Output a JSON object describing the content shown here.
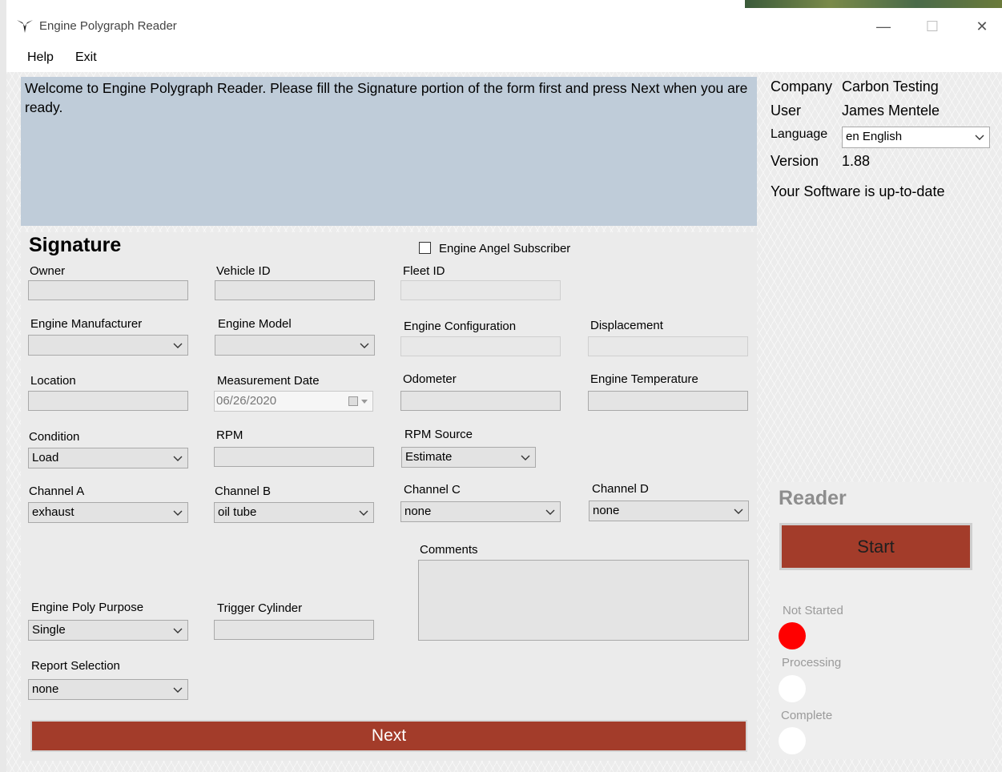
{
  "window": {
    "title": "Engine Polygraph Reader",
    "minimize": "—",
    "maximize": "☐",
    "close": "✕"
  },
  "menu": {
    "help": "Help",
    "exit": "Exit"
  },
  "welcome_text": "Welcome to Engine Polygraph Reader. Please fill the Signature portion of the form first and press Next when you are ready.",
  "info": {
    "company_label": "Company",
    "company_value": "Carbon Testing",
    "user_label": "User",
    "user_value": "James Mentele",
    "language_label": "Language",
    "language_value": "en English",
    "version_label": "Version",
    "version_value": "1.88",
    "update_status": "Your Software is up-to-date"
  },
  "form": {
    "title": "Signature",
    "subscriber_label": "Engine Angel Subscriber",
    "owner_label": "Owner",
    "vehicle_id_label": "Vehicle ID",
    "fleet_id_label": "Fleet ID",
    "engine_manufacturer_label": "Engine Manufacturer",
    "engine_model_label": "Engine Model",
    "engine_configuration_label": "Engine Configuration",
    "displacement_label": "Displacement",
    "location_label": "Location",
    "measurement_date_label": "Measurement Date",
    "measurement_date_value": "06/26/2020",
    "odometer_label": "Odometer",
    "engine_temperature_label": "Engine Temperature",
    "condition_label": "Condition",
    "condition_value": "Load",
    "rpm_label": "RPM",
    "rpm_source_label": "RPM Source",
    "rpm_source_value": "Estimate",
    "channel_a_label": "Channel A",
    "channel_a_value": "exhaust",
    "channel_b_label": "Channel B",
    "channel_b_value": "oil tube",
    "channel_c_label": "Channel C",
    "channel_c_value": "none",
    "channel_d_label": "Channel D",
    "channel_d_value": "none",
    "comments_label": "Comments",
    "purpose_label": "Engine Poly Purpose",
    "purpose_value": "Single",
    "trigger_label": "Trigger Cylinder",
    "report_label": "Report Selection",
    "report_value": "none",
    "next_label": "Next"
  },
  "reader": {
    "title": "Reader",
    "start_label": "Start",
    "not_started_label": "Not Started",
    "processing_label": "Processing",
    "complete_label": "Complete",
    "not_started_color": "#ff0000",
    "idle_color": "#ffffff"
  }
}
